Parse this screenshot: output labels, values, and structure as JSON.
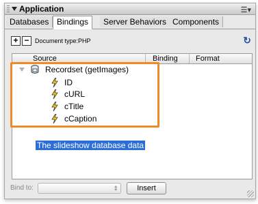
{
  "panel": {
    "title": "Application",
    "tabs": [
      "Databases",
      "Bindings",
      "Server Behaviors",
      "Components"
    ],
    "active_tab": "Bindings"
  },
  "toolbar": {
    "add_label": "+",
    "remove_label": "−",
    "document_type": "Document type:PHP"
  },
  "table": {
    "columns": [
      "Source",
      "Binding",
      "Format"
    ],
    "recordset": "Recordset (getImages)",
    "fields": [
      "ID",
      "cURL",
      "cTitle",
      "cCaption"
    ]
  },
  "annotation": {
    "caption": "The slideshow database data",
    "highlight_color": "#f08a24"
  },
  "bottom": {
    "bind_to_label": "Bind to:",
    "insert_label": "Insert"
  },
  "icons": {
    "menu": "options-menu-icon",
    "refresh": "refresh-icon",
    "recordset": "recordset-icon",
    "field": "lightning-bolt-icon"
  }
}
